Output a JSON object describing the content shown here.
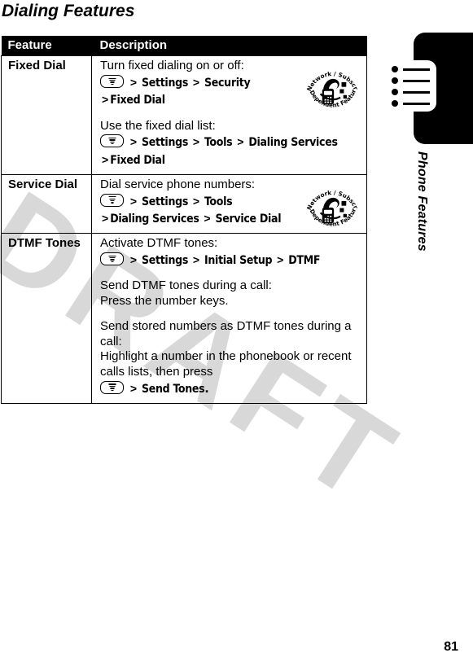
{
  "page": {
    "title": "Dialing Features",
    "number": "81",
    "watermark": "DRAFT"
  },
  "side_tab": {
    "label": "Phone Features",
    "icon": "list-icon"
  },
  "table": {
    "columns": [
      "Feature",
      "Description"
    ],
    "rows": [
      {
        "feature": "Fixed Dial",
        "badge": "network-subscription-dependent-feature-badge",
        "badge_text_top": "Network / Subscription",
        "badge_text_bottom": "Dependent  Feature",
        "blocks": [
          {
            "lines": [
              {
                "type": "plain",
                "text": "Turn fixed dialing on or off:"
              },
              {
                "type": "path",
                "menu_key": true,
                "items": [
                  "Settings",
                  "Security"
                ]
              },
              {
                "type": "path",
                "menu_key": false,
                "items": [
                  "Fixed Dial"
                ]
              }
            ]
          },
          {
            "lines": [
              {
                "type": "plain",
                "text": "Use the fixed dial list:"
              },
              {
                "type": "path",
                "menu_key": true,
                "items": [
                  "Settings",
                  "Tools",
                  "Dialing Services"
                ]
              },
              {
                "type": "path",
                "menu_key": false,
                "items": [
                  "Fixed Dial"
                ]
              }
            ]
          }
        ]
      },
      {
        "feature": "Service Dial",
        "badge": "network-subscription-dependent-feature-badge",
        "badge_text_top": "Network / Subscription",
        "badge_text_bottom": "Dependent  Feature",
        "blocks": [
          {
            "lines": [
              {
                "type": "plain",
                "text": "Dial service phone numbers:"
              },
              {
                "type": "path",
                "menu_key": true,
                "items": [
                  "Settings",
                  "Tools"
                ]
              },
              {
                "type": "path",
                "menu_key": false,
                "items": [
                  "Dialing Services",
                  "Service Dial"
                ]
              }
            ]
          }
        ]
      },
      {
        "feature": "DTMF Tones",
        "badge": null,
        "blocks": [
          {
            "lines": [
              {
                "type": "plain",
                "text": "Activate DTMF tones:"
              },
              {
                "type": "path",
                "menu_key": true,
                "items": [
                  "Settings",
                  "Initial Setup",
                  "DTMF"
                ]
              }
            ]
          },
          {
            "lines": [
              {
                "type": "plain",
                "text": "Send DTMF tones during a call:"
              },
              {
                "type": "plain",
                "text": "Press the number keys."
              }
            ]
          },
          {
            "lines": [
              {
                "type": "plain",
                "text": "Send stored numbers as DTMF tones during a call:"
              },
              {
                "type": "plain",
                "text": "Highlight a number in the phonebook or recent calls lists, then press"
              },
              {
                "type": "path",
                "menu_key": true,
                "items": [
                  "Send Tones"
                ],
                "trailing": "."
              }
            ]
          }
        ]
      }
    ]
  }
}
